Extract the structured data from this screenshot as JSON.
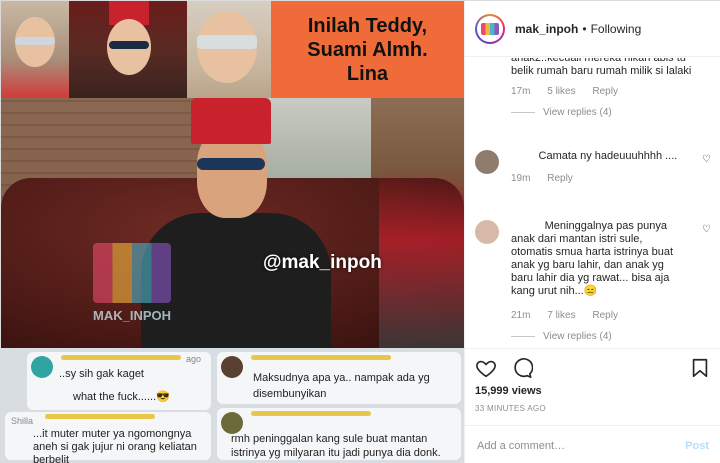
{
  "media": {
    "title_text": "Inilah Teddy,\nSuami Almh.\nLina",
    "watermark": "@mak_inpoh",
    "logo_text": "MAK_INPOH",
    "comments": [
      {
        "text": "..sy sih gak kaget",
        "sub": "what the fuck......😎",
        "meta": "ago"
      },
      {
        "text": "Maksudnya apa ya.. nampak ada yg disembunyikan",
        "meta": ""
      },
      {
        "text": "...it muter muter ya ngomongnya aneh si gak jujur ni orang keliatan berbelit",
        "meta": "Shilla"
      },
      {
        "text": "rmh peninggalan kang sule buat mantan istrinya yg milyaran itu jadi punya dia donk.",
        "meta": ""
      }
    ]
  },
  "header": {
    "username": "mak_inpoh",
    "separator": "•",
    "follow_status": "Following"
  },
  "comments": [
    {
      "text": "anak2..kecuali mereka nikah abis tu belik rumah baru rumah milik si lalaki",
      "time": "17m",
      "likes": "5 likes",
      "reply": "Reply",
      "view_replies": "View replies (4)"
    },
    {
      "name": "        ",
      "text": "Camata ny hadeuuuhhhh ....",
      "time": "19m",
      "reply": "Reply"
    },
    {
      "name": "          ",
      "text": "Meninggalnya pas punya anak dari mantan istri sule, otomatis smua harta istrinya buat anak yg baru lahir, dan anak yg baru lahir dia yg rawat... bisa aja kang urut nih...😑",
      "time": "21m",
      "likes": "7 likes",
      "reply": "Reply",
      "view_replies": "View replies (4)"
    }
  ],
  "footer": {
    "views": "15,999 views",
    "timestamp": "33 MINUTES AGO",
    "add_comment_placeholder": "Add a comment…",
    "post_label": "Post"
  }
}
